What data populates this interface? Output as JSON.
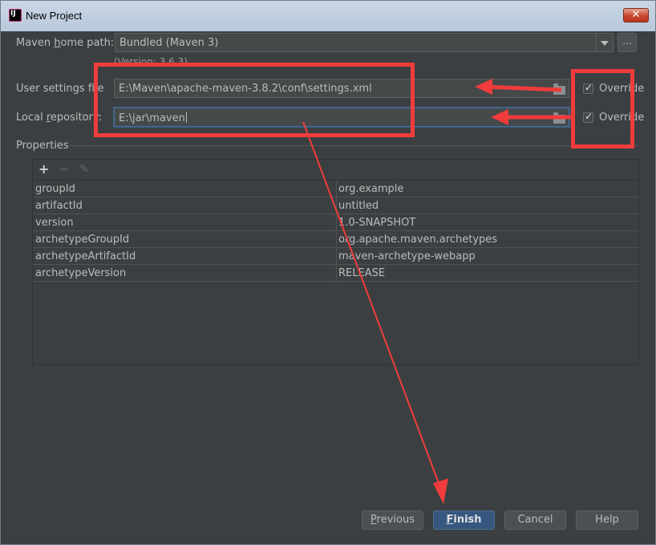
{
  "window": {
    "title": "New Project",
    "close_symbol": "✕",
    "app_icon": "intellij-idea-icon"
  },
  "form": {
    "maven_home": {
      "label_pre": "Maven ",
      "label_u": "h",
      "label_post": "ome path:",
      "value": "Bundled (Maven 3)",
      "browse_label": "...",
      "version_note": "(Version: 3.6.3)"
    },
    "user_settings": {
      "label": "User settings file",
      "value": "E:\\Maven\\apache-maven-3.8.2\\conf\\settings.xml",
      "override_label": "Override",
      "override_checked": true
    },
    "local_repo": {
      "label_pre": "Local ",
      "label_u": "r",
      "label_post": "epository:",
      "value": "E:\\jar\\maven",
      "override_label": "Override",
      "override_checked": true
    }
  },
  "properties": {
    "section_label": "Properties",
    "toolbar": {
      "add": "+",
      "remove": "−",
      "edit": "✎"
    },
    "rows": [
      {
        "key": "groupId",
        "value": "org.example"
      },
      {
        "key": "artifactId",
        "value": "untitled"
      },
      {
        "key": "version",
        "value": "1.0-SNAPSHOT"
      },
      {
        "key": "archetypeGroupId",
        "value": "org.apache.maven.archetypes"
      },
      {
        "key": "archetypeArtifactId",
        "value": "maven-archetype-webapp"
      },
      {
        "key": "archetypeVersion",
        "value": "RELEASE"
      }
    ]
  },
  "buttons": {
    "previous": {
      "u": "P",
      "rest": "revious"
    },
    "finish": {
      "u": "F",
      "rest": "inish"
    },
    "cancel": "Cancel",
    "help": "Help"
  },
  "colors": {
    "background": "#3c3f41",
    "field": "#45494a",
    "text": "#bbbbbb",
    "default_button": "#365880",
    "annotation": "#f03c3c"
  }
}
